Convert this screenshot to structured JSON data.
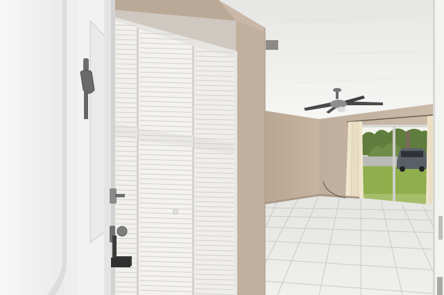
{
  "scene": {
    "kind": "interior-photo",
    "subjects": [
      "front-door",
      "louvered-closet",
      "ceiling-fan",
      "tile-floor",
      "sliding-glass-door",
      "curtain",
      "parked-car",
      "lawn",
      "trees"
    ]
  },
  "colors": {
    "wall": "#c9b8a7",
    "wall-shadow": "#b7a493",
    "ceiling": "#f0efec",
    "floor": "#e8e8e6",
    "door": "#f4f4f4",
    "closet": "#f2f1ee",
    "lawn": "#8fae4c",
    "trees": "#5f7d3c",
    "curtain": "#ece3cc"
  }
}
